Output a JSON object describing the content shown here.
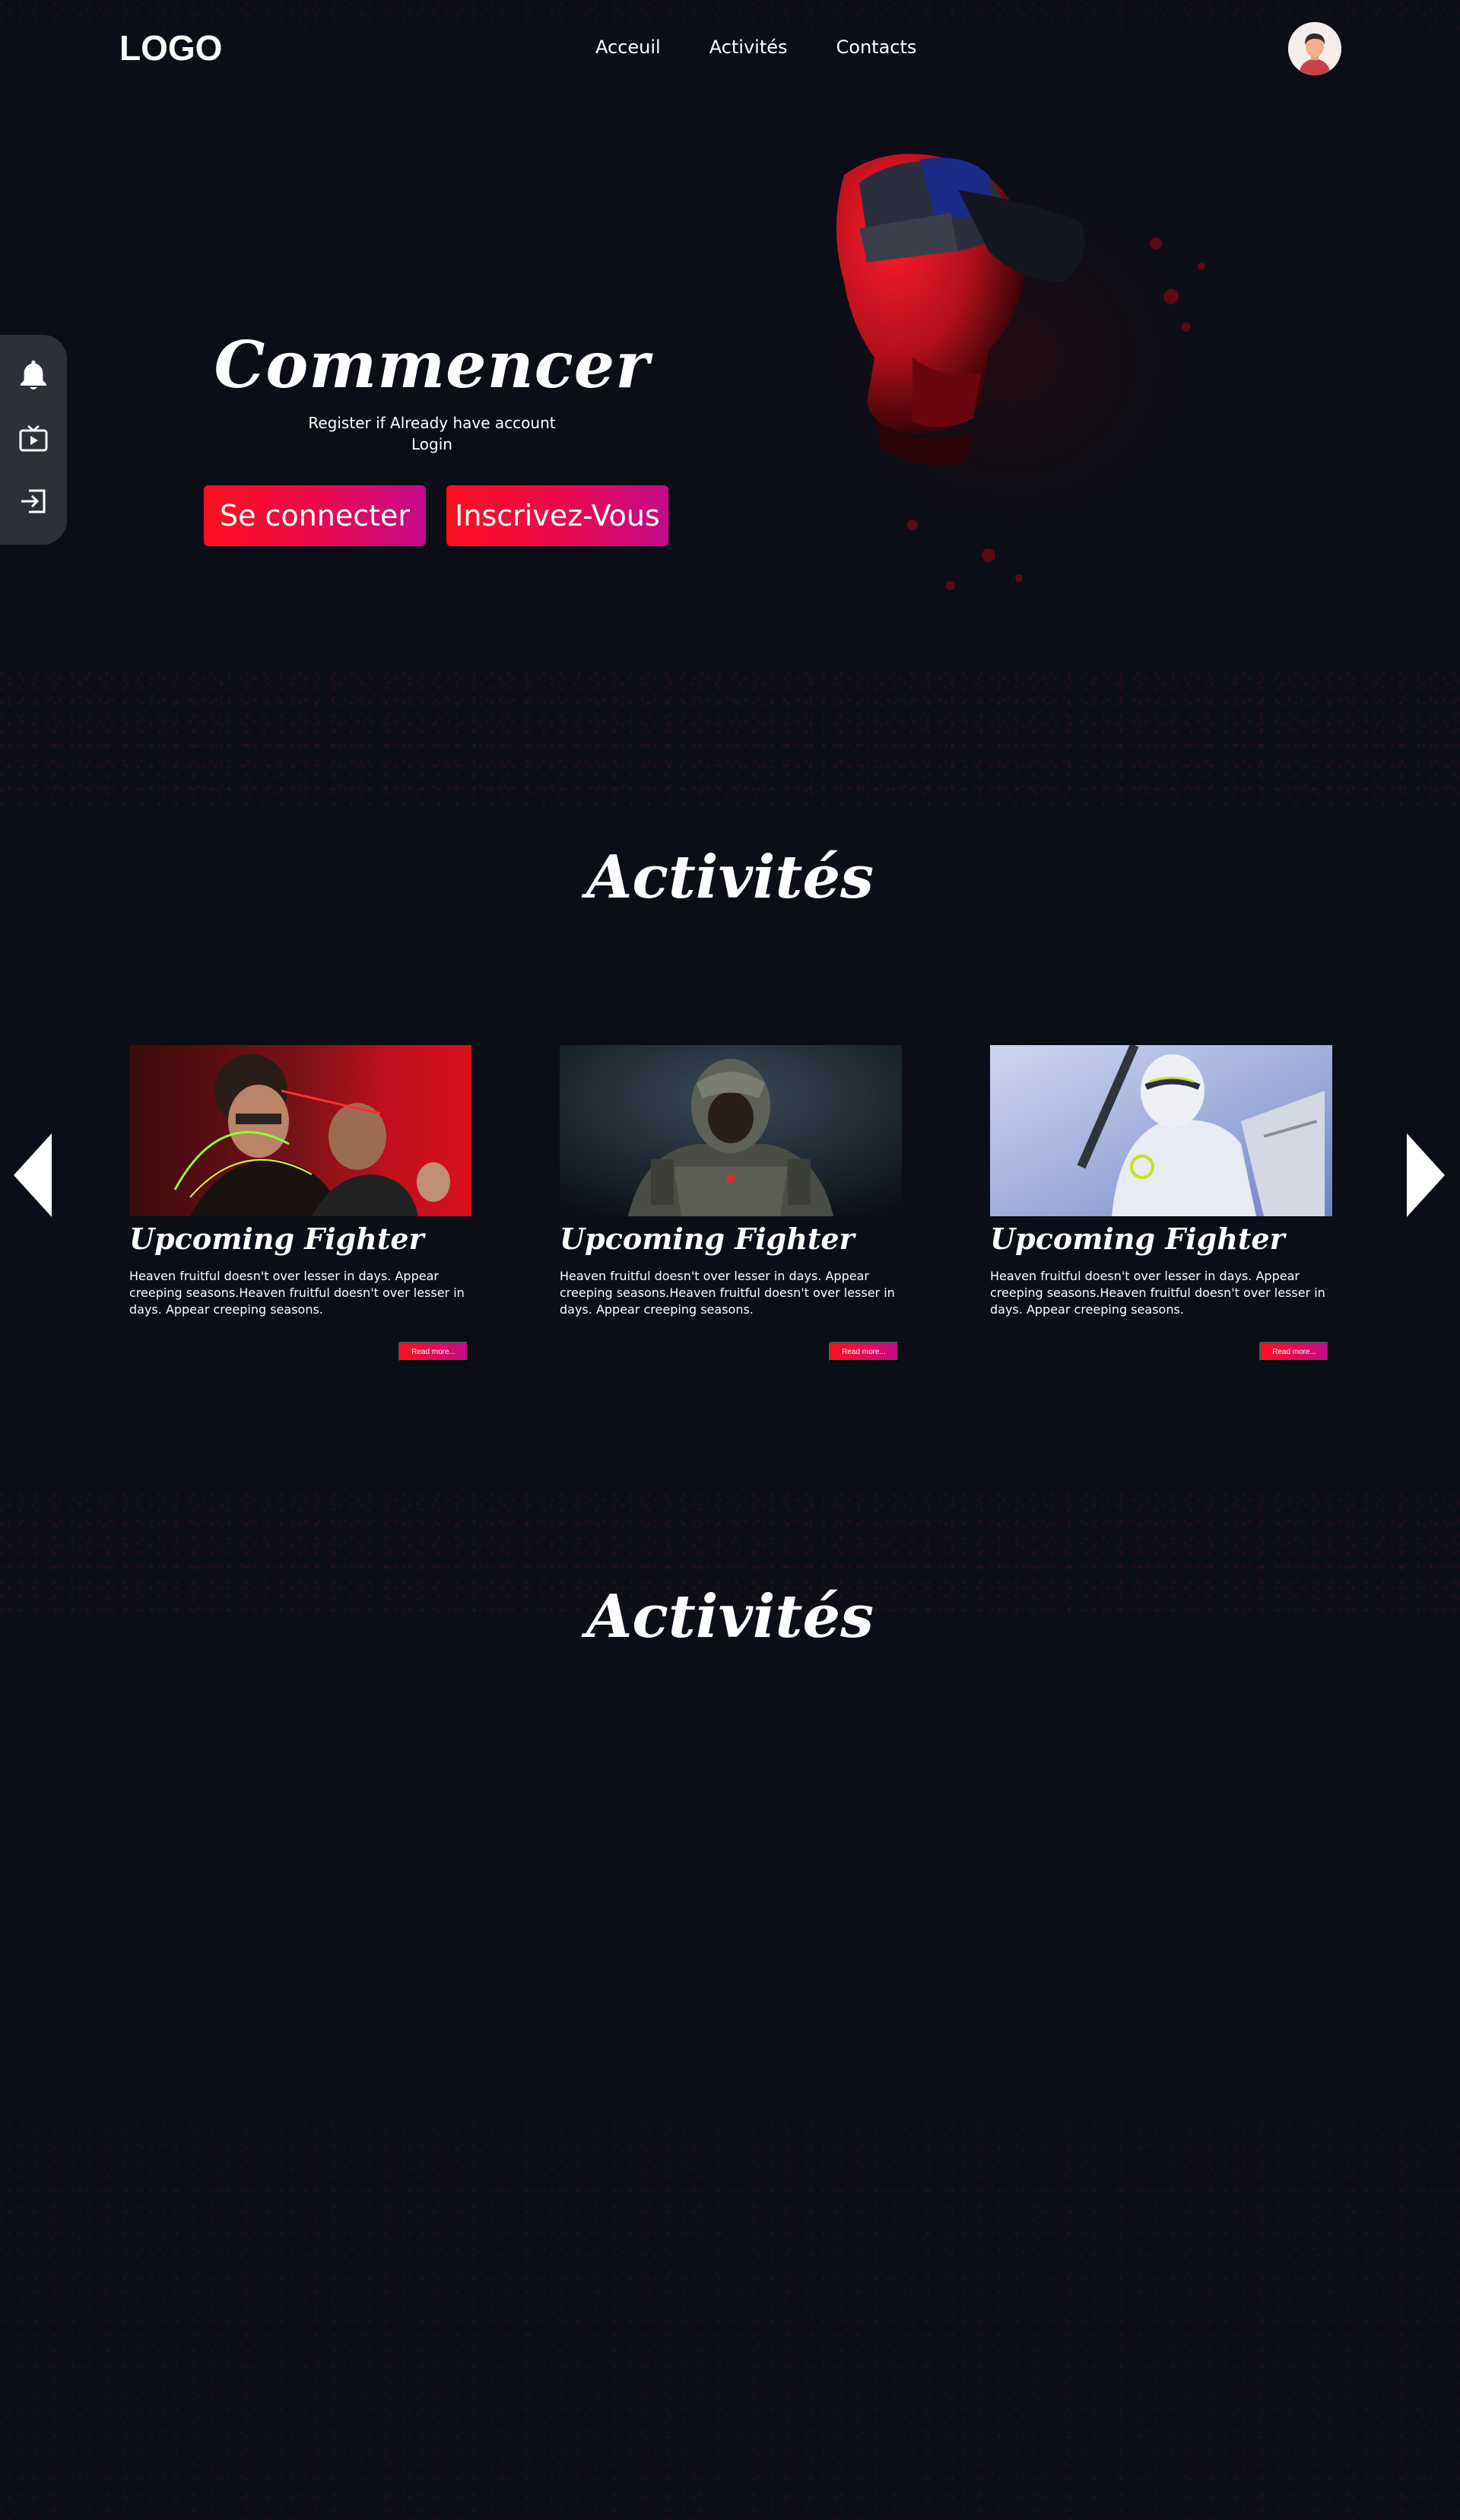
{
  "header": {
    "logo": "LOGO",
    "nav": [
      "Acceuil",
      "Activités",
      "Contacts"
    ]
  },
  "sidebar": {
    "items": [
      {
        "icon": "bell-icon"
      },
      {
        "icon": "tv-play-icon"
      },
      {
        "icon": "login-icon"
      }
    ]
  },
  "hero": {
    "title": "Commencer",
    "subtitle_line1": "Register if Already have account",
    "subtitle_line2": "Login",
    "login_button": "Se connecter",
    "register_button": "Inscrivez-Vous"
  },
  "activities": {
    "title": "Activités",
    "cards": [
      {
        "title": "Upcoming Fighter",
        "text": "Heaven fruitful doesn't over lesser in days. Appear creeping seasons.Heaven fruitful doesn't over lesser in days. Appear creeping seasons.",
        "button": "Read more..."
      },
      {
        "title": "Upcoming Fighter",
        "text": "Heaven fruitful doesn't over lesser in days. Appear creeping seasons.Heaven fruitful doesn't over lesser in days. Appear creeping seasons.",
        "button": "Read more..."
      },
      {
        "title": "Upcoming Fighter",
        "text": "Heaven fruitful doesn't over lesser in days. Appear creeping seasons.Heaven fruitful doesn't over lesser in days. Appear creeping seasons.",
        "button": "Read more..."
      }
    ]
  },
  "activities2": {
    "title": "Activités"
  },
  "colors": {
    "background": "#0b0e16",
    "accent_start": "#ff0f1e",
    "accent_end": "#c40a8a",
    "sidebar": "#2e3038"
  }
}
